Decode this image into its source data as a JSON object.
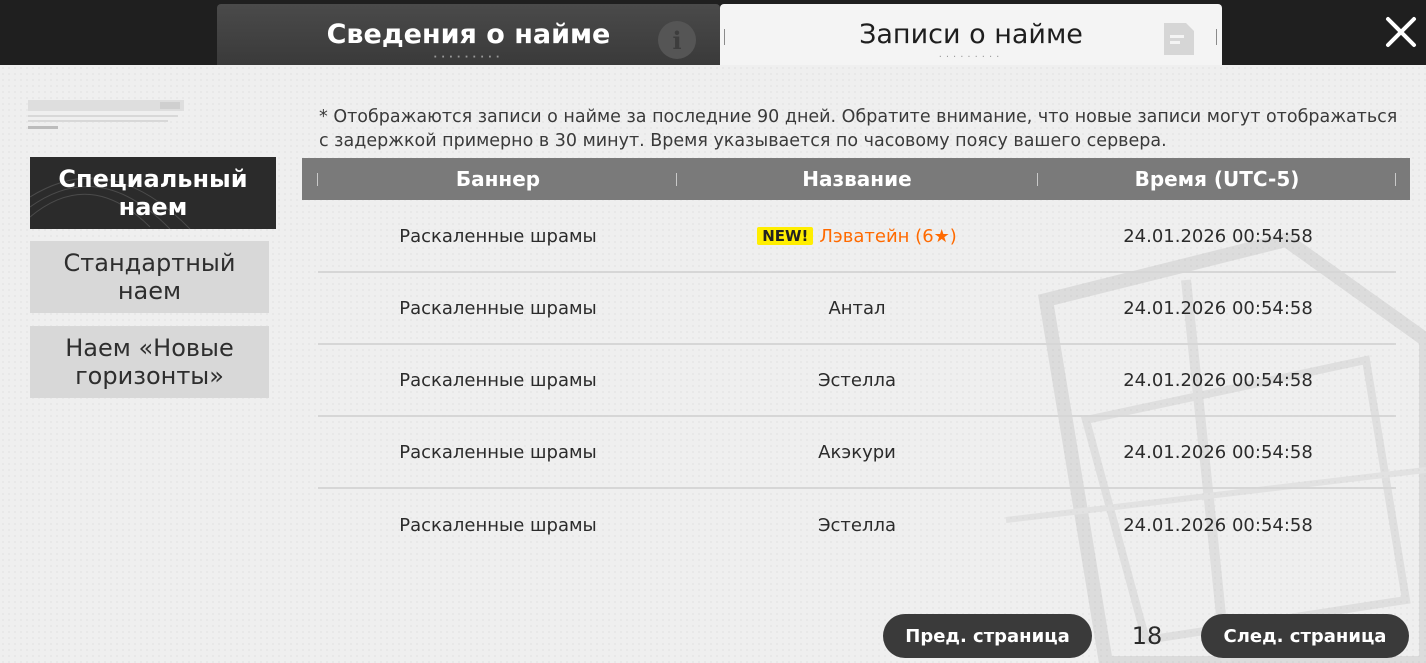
{
  "tabs": {
    "info_label": "Сведения о найме",
    "records_label": "Записи о найме",
    "active": "records"
  },
  "icons": {
    "info": "info-icon",
    "records": "document-icon",
    "close": "close-icon"
  },
  "colors": {
    "topbar": "#1f1f1f",
    "active_menu": "#2b2b2b",
    "table_header": "#7a7a7a",
    "new_badge": "#ffee00",
    "highlight_name": "#ff6a00"
  },
  "menu": {
    "items": [
      {
        "label": "Специальный наем",
        "active": true
      },
      {
        "label": "Стандартный наем",
        "active": false
      },
      {
        "label": "Наем «Новые горизонты»",
        "active": false
      }
    ]
  },
  "notice": "* Отображаются записи о найме за последние 90 дней. Обратите внимание, что новые записи могут отображаться с задержкой примерно в 30 минут. Время указывается по часовому поясу вашего сервера.",
  "table": {
    "headers": {
      "banner": "Баннер",
      "name": "Название",
      "time": "Время (UTC-5)"
    },
    "rows": [
      {
        "banner": "Раскаленные шрамы",
        "badge": "NEW!",
        "name": "Лэватейн (6★)",
        "time": "24.01.2026 00:54:58"
      },
      {
        "banner": "Раскаленные шрамы",
        "name": "Антал",
        "time": "24.01.2026 00:54:58"
      },
      {
        "banner": "Раскаленные шрамы",
        "name": "Эстелла",
        "time": "24.01.2026 00:54:58"
      },
      {
        "banner": "Раскаленные шрамы",
        "name": "Акэкури",
        "time": "24.01.2026 00:54:58"
      },
      {
        "banner": "Раскаленные шрамы",
        "name": "Эстелла",
        "time": "24.01.2026 00:54:58"
      }
    ]
  },
  "pagination": {
    "prev_label": "Пред. страница",
    "next_label": "След. страница",
    "current_page": "18"
  }
}
